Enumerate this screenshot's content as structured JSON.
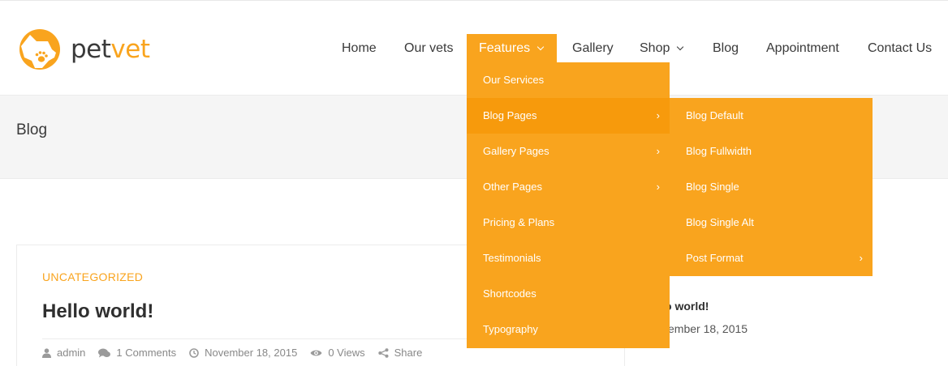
{
  "brand": {
    "part1": "pet",
    "part2": "vet",
    "accent": "#f9a41e"
  },
  "nav": {
    "items": [
      {
        "label": "Home"
      },
      {
        "label": "Our vets"
      },
      {
        "label": "Features",
        "active": true,
        "has_dropdown": true
      },
      {
        "label": "Gallery"
      },
      {
        "label": "Shop",
        "has_dropdown": true
      },
      {
        "label": "Blog"
      },
      {
        "label": "Appointment"
      },
      {
        "label": "Contact Us"
      }
    ]
  },
  "features_menu": [
    {
      "label": "Our Services"
    },
    {
      "label": "Blog Pages",
      "submenu": true,
      "hover": true
    },
    {
      "label": "Gallery Pages",
      "submenu": true
    },
    {
      "label": "Other Pages",
      "submenu": true
    },
    {
      "label": "Pricing & Plans"
    },
    {
      "label": "Testimonials"
    },
    {
      "label": "Shortcodes"
    },
    {
      "label": "Typography"
    }
  ],
  "blog_pages_menu": [
    {
      "label": "Blog Default"
    },
    {
      "label": "Blog Fullwidth"
    },
    {
      "label": "Blog Single"
    },
    {
      "label": "Blog Single Alt"
    },
    {
      "label": "Post Format",
      "submenu": true
    }
  ],
  "page_title": "Blog",
  "post": {
    "category": "UNCATEGORIZED",
    "title": "Hello world!",
    "author": "admin",
    "comments": "1 Comments",
    "date": "November 18, 2015",
    "views": "0 Views",
    "share": "Share"
  },
  "sidebar": {
    "recent_title": "o world!",
    "recent_date": "vember 18, 2015"
  },
  "icons": {
    "logo": "dog-paw-logo-icon",
    "author": "user-icon",
    "comments": "comments-icon",
    "date": "clock-icon",
    "views": "eye-icon",
    "share": "share-icon",
    "submenu": "chevron-right-icon"
  }
}
